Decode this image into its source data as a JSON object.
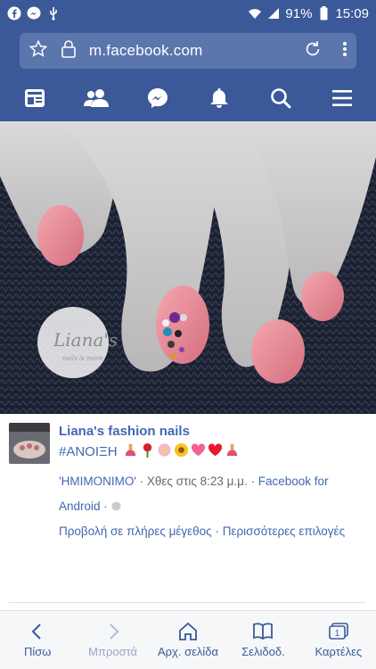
{
  "status": {
    "battery": "91%",
    "time": "15:09"
  },
  "browser": {
    "url": "m.facebook.com"
  },
  "fb_nav": {
    "items": [
      "news-feed",
      "friends",
      "messenger",
      "notifications",
      "search",
      "menu"
    ]
  },
  "photo": {
    "watermark": "Liana's",
    "watermark_sub": "nails & more"
  },
  "post": {
    "page_name": "Liana's fashion nails",
    "hashtag": "#ΑΝΟΙΞΗ",
    "meta_line1_album": "'ΗΜΙΜΟΝΙΜΟ'",
    "meta_line1_time": " · Χθες στις 8:23 μ.μ. · ",
    "meta_line1_app": "Facebook for",
    "meta_line2": "Android · ",
    "action_full_size": "Προβολή σε πλήρες μέγεθος",
    "action_sep": " · ",
    "action_more": "Περισσότερες επιλογές"
  },
  "bottom_bar": {
    "back": "Πίσω",
    "forward": "Μπροστά",
    "home": "Αρχ. σελίδα",
    "bookmarks": "Σελιδοδ.",
    "tabs": "Καρτέλες",
    "tabs_count": "1"
  },
  "colors": {
    "brand": "#3b5998",
    "link": "#4267b2",
    "nail_pink": "#e88593"
  }
}
